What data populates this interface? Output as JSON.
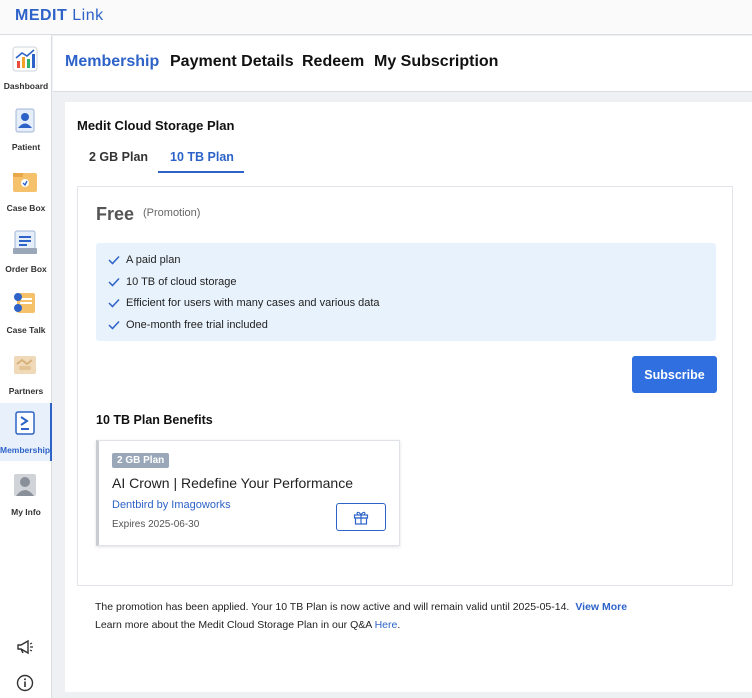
{
  "app": {
    "brand_main": "MEDIT",
    "brand_sub": "Link"
  },
  "sidebar": {
    "items": [
      {
        "label": "Dashboard",
        "icon": "dashboard-icon"
      },
      {
        "label": "Patient",
        "icon": "patient-icon"
      },
      {
        "label": "Case Box",
        "icon": "case-box-icon"
      },
      {
        "label": "Order Box",
        "icon": "order-box-icon"
      },
      {
        "label": "Case Talk",
        "icon": "case-talk-icon"
      },
      {
        "label": "Partners",
        "icon": "partners-icon"
      },
      {
        "label": "Membership",
        "icon": "membership-icon",
        "active": true
      },
      {
        "label": "My Info",
        "icon": "my-info-icon"
      }
    ],
    "bottom": [
      "megaphone-icon",
      "info-icon"
    ]
  },
  "header": {
    "tabs": [
      {
        "label": "Membership",
        "active": true
      },
      {
        "label": "Payment Details"
      },
      {
        "label": "Redeem"
      },
      {
        "label": "My Subscription"
      }
    ]
  },
  "plan": {
    "title": "Medit Cloud Storage Plan",
    "tabs": [
      {
        "label": "2 GB Plan"
      },
      {
        "label": "10 TB Plan",
        "active": true
      }
    ],
    "price": "Free",
    "price_note": "(Promotion)",
    "features": [
      "A paid plan",
      "10 TB of cloud storage",
      "Efficient for users with many cases and various data",
      "One-month free trial included"
    ],
    "subscribe_label": "Subscribe",
    "benefits_title": "10 TB Plan Benefits",
    "benefit": {
      "badge": "2 GB Plan",
      "name": "AI Crown | Redefine Your Performance",
      "vendor": "Dentbird by Imagoworks",
      "expiry": "Expires 2025-06-30"
    }
  },
  "notes": {
    "line1": "The promotion has been applied. Your 10 TB Plan is now active and will remain valid until 2025-05-14.",
    "view_more": "View More",
    "line2_prefix": "Learn more about the Medit Cloud Storage Plan in our Q&A",
    "here": "Here",
    "line2_suffix": "."
  },
  "colors": {
    "accent": "#2d63c8",
    "button": "#2f6fe0",
    "feature_bg": "#e8f2fc"
  }
}
